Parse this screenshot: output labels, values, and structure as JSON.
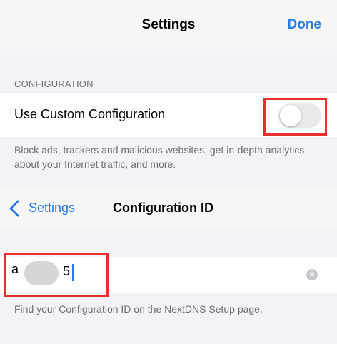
{
  "settings_nav": {
    "title": "Settings",
    "done_label": "Done"
  },
  "configuration_section": {
    "header": "CONFIGURATION",
    "custom_config_label": "Use Custom Configuration",
    "custom_config_enabled": false,
    "footer": "Block ads, trackers and malicious websites, get in-depth analytics about your Internet traffic, and more."
  },
  "config_nav": {
    "back_label": "Settings",
    "title": "Configuration ID"
  },
  "config_id_field": {
    "value_prefix": "a",
    "value_suffix": "5",
    "clear_icon": "clear-icon",
    "footer": "Find your Configuration ID on the NextDNS Setup page."
  },
  "colors": {
    "accent": "#2a7be4",
    "highlight": "#e8302d",
    "background": "#f2f2f7"
  }
}
